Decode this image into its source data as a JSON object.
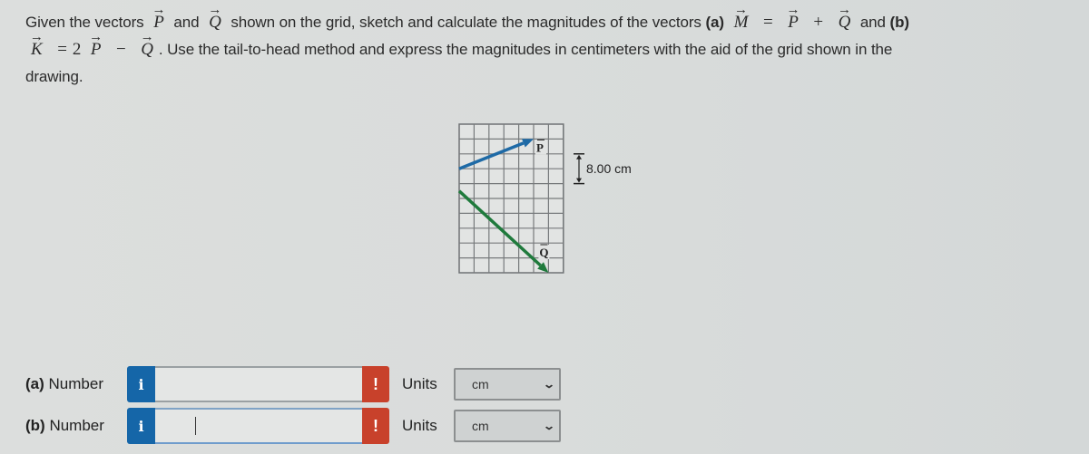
{
  "question": {
    "line1": {
      "t1": "Given the vectors",
      "v1": "P",
      "t2": "and",
      "v2": "Q",
      "t3": "shown on the grid, sketch and calculate the magnitudes of the vectors",
      "part_a": "(a)",
      "m": "M",
      "eq": "=",
      "p": "P",
      "plus": "+",
      "q": "Q",
      "and": "and",
      "part_b": "(b)"
    },
    "line2": {
      "k": "K",
      "eq": "=",
      "coef": "2",
      "p": "P",
      "minus": "−",
      "q": "Q",
      "text": ". Use the tail-to-head method and express the magnitudes in centimeters with the aid of the grid shown in the"
    },
    "line3": "drawing.",
    "arrow_glyph": "→"
  },
  "figure": {
    "grid_cols": 7,
    "grid_rows": 10,
    "scale_label": "8.00 cm",
    "scale_cells": 2,
    "vectors": [
      {
        "name": "P",
        "from": [
          0,
          3
        ],
        "to": [
          5,
          1
        ],
        "color": "#1e6aa6"
      },
      {
        "name": "Q",
        "from": [
          0,
          4.5
        ],
        "to": [
          6,
          10
        ],
        "color": "#1f7a3c"
      }
    ]
  },
  "answers": [
    {
      "part": "(a)",
      "label": "Number",
      "info": "i",
      "value": "",
      "error": "!",
      "units_label": "Units",
      "unit": "cm"
    },
    {
      "part": "(b)",
      "label": "Number",
      "info": "i",
      "value": "",
      "error": "!",
      "units_label": "Units",
      "unit": "cm"
    }
  ],
  "colors": {
    "info": "#1566a8",
    "error": "#c8412b"
  }
}
